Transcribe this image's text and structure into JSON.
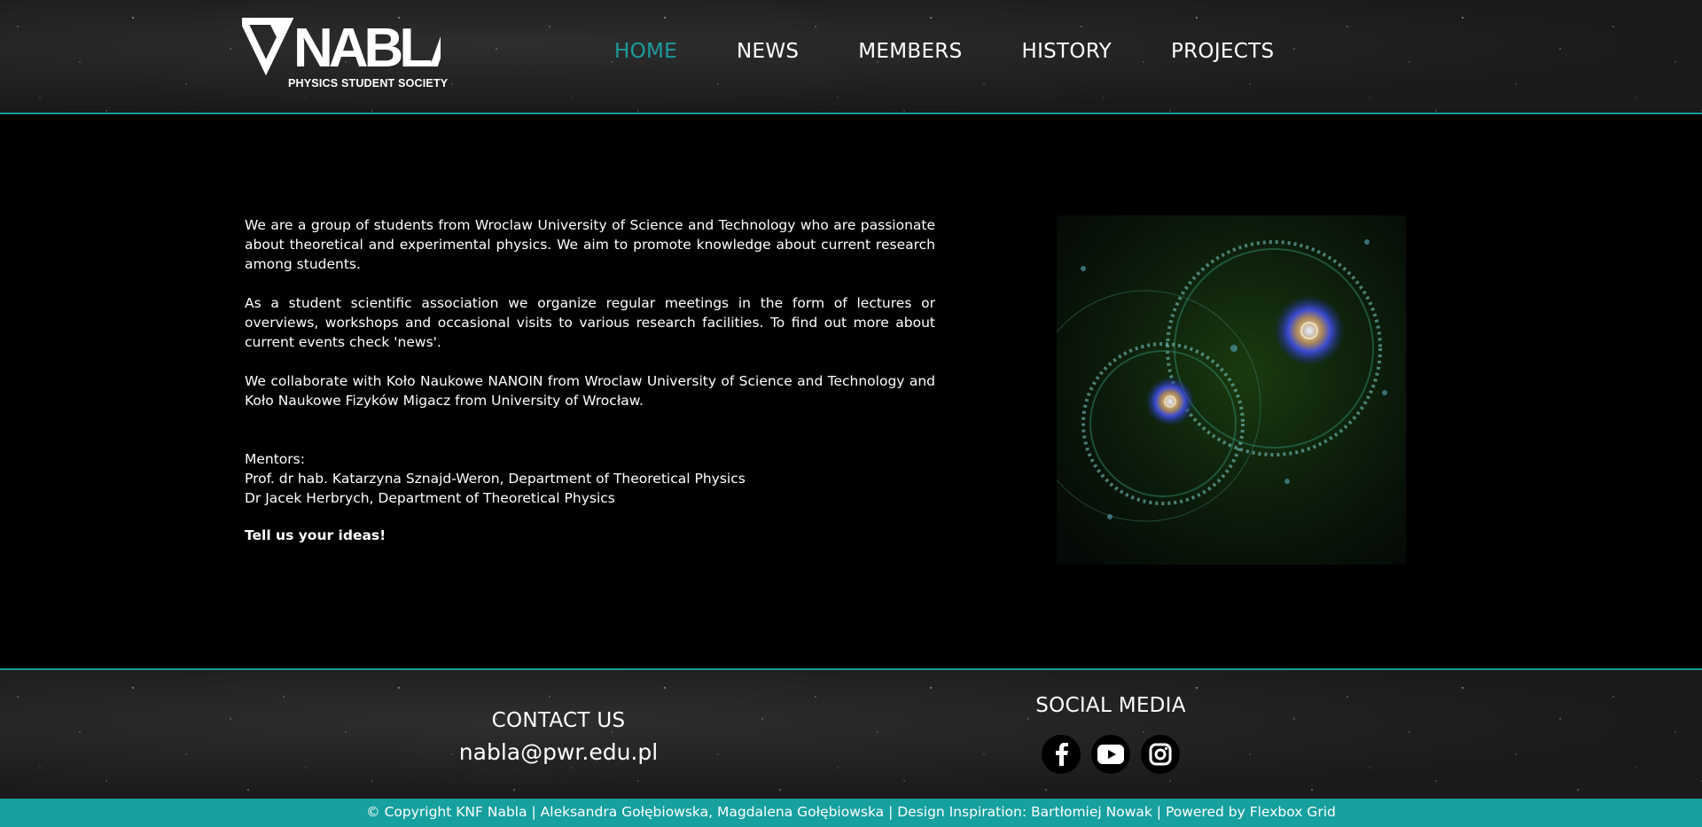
{
  "logo": {
    "text": "NABLA",
    "subtitle": "PHYSICS STUDENT SOCIETY"
  },
  "nav": {
    "items": [
      {
        "label": "HOME",
        "active": true
      },
      {
        "label": "NEWS",
        "active": false
      },
      {
        "label": "MEMBERS",
        "active": false
      },
      {
        "label": "HISTORY",
        "active": false
      },
      {
        "label": "PROJECTS",
        "active": false
      }
    ]
  },
  "about": {
    "paragraphs": [
      "We are a group of students from Wroclaw University of Science and Technology who are passionate about theoretical and experimental physics. We aim to promote knowledge about current research among students.",
      "As a student scientific association we organize regular meetings in the form of lectures or overviews, workshops and occasional visits to various research facilities. To find out more about current events check 'news'.",
      "We collaborate with Koło Naukowe NANOIN from Wroclaw University of Science and Technology and Koło Naukowe Fizyków Migacz from University of Wrocław."
    ],
    "mentors_label": "Mentors:",
    "mentors": [
      "Prof. dr hab. Katarzyna Sznajd-Weron, Department of Theoretical Physics",
      "Dr Jacek Herbrych, Department of Theoretical Physics"
    ],
    "cta": "Tell us your ideas!"
  },
  "footer": {
    "contact_title": "CONTACT US",
    "contact_email": "nabla@pwr.edu.pl",
    "social_title": "SOCIAL MEDIA",
    "social_icons": [
      "facebook-icon",
      "youtube-icon",
      "instagram-icon"
    ],
    "copyright": "© Copyright KNF Nabla | Aleksandra Gołębiowska, Magdalena Gołębiowska | Design Inspiration: Bartłomiej Nowak | Powered by Flexbox Grid"
  },
  "colors": {
    "accent": "#1a9c9c",
    "footer_bar": "#16a09f",
    "background": "#000000"
  }
}
